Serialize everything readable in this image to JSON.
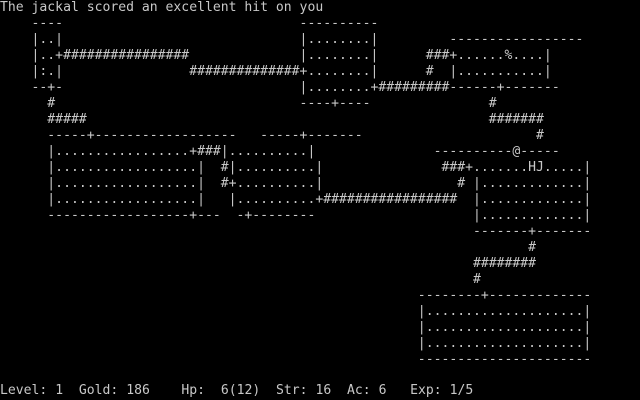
{
  "message": "The jackal scored an excellent hit on you",
  "map_rows": [
    "    ----                              ----------                           ",
    "    |..|                              |........|         ----------------- ",
    "    |..+################              |........|      ###+......%....|     ",
    "    |:.|                ##############+........|      #  |...........|     ",
    "    --+-                              |........+#########------+-------    ",
    "      #                               ----+----               #           ",
    "      #####                                                   #######      ",
    "      -----+------------------   -----+-------                      #      ",
    "      |.................+###|..........|               ----------@-----   ",
    "      |..................|  #|..........|               ###+.......HJ.....|",
    "      |..................|  #+..........|                 # |.............|",
    "      |..................|   |..........+#################  |.............|",
    "      ------------------+---  -+--------                    |.............|",
    "                                                            -------+-------",
    "                                                                   #       ",
    "                                                            ########       ",
    "                                                            #              ",
    "                                                     --------+-------------",
    "                                                     |....................|",
    "                                                     |....................|",
    "                                                     |....................|",
    "                                                     ----------------------"
  ],
  "status": {
    "level_label": "Level:",
    "level": "1",
    "gold_label": "Gold:",
    "gold": "186",
    "hp_label": "Hp:",
    "hp": "6(12)",
    "str_label": "Str:",
    "str": "16",
    "ac_label": "Ac:",
    "ac": "6",
    "exp_label": "Exp:",
    "exp": "1/5"
  },
  "colors": {
    "background": "#000000",
    "text": "#c8c8c8"
  }
}
